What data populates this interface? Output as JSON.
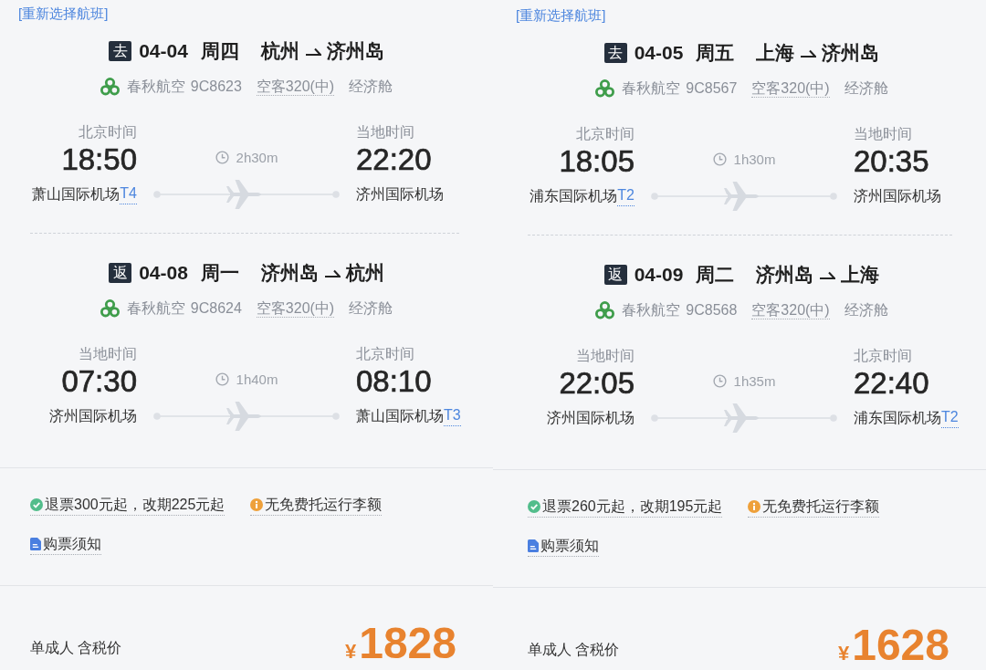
{
  "panels": [
    {
      "reselect_link": "[重新选择航班]",
      "segments": [
        {
          "badge": "去",
          "date": "04-04",
          "weekday": "周四",
          "origin": "杭州",
          "destination": "济州岛",
          "airline": "春秋航空",
          "flight_no": "9C8623",
          "aircraft": "空客320(中)",
          "cabin": "经济舱",
          "duration": "2h30m",
          "departure": {
            "zone": "北京时间",
            "time": "18:50",
            "airport": "萧山国际机场",
            "terminal": "T4"
          },
          "arrival": {
            "zone": "当地时间",
            "time": "22:20",
            "airport": "济州国际机场"
          }
        },
        {
          "badge": "返",
          "date": "04-08",
          "weekday": "周一",
          "origin": "济州岛",
          "destination": "杭州",
          "airline": "春秋航空",
          "flight_no": "9C8624",
          "aircraft": "空客320(中)",
          "cabin": "经济舱",
          "duration": "1h40m",
          "departure": {
            "zone": "当地时间",
            "time": "07:30",
            "airport": "济州国际机场"
          },
          "arrival": {
            "zone": "北京时间",
            "time": "08:10",
            "airport": "萧山国际机场",
            "terminal": "T3"
          }
        }
      ],
      "notes": [
        {
          "kind": "check",
          "text": "退票300元起，改期225元起"
        },
        {
          "kind": "info",
          "text": "无免费托运行李额"
        },
        {
          "kind": "doc",
          "text": "购票须知"
        }
      ],
      "price": {
        "label": "单成人 含税价",
        "currency": "¥",
        "amount": "1828"
      }
    },
    {
      "reselect_link": "[重新选择航班]",
      "segments": [
        {
          "badge": "去",
          "date": "04-05",
          "weekday": "周五",
          "origin": "上海",
          "destination": "济州岛",
          "airline": "春秋航空",
          "flight_no": "9C8567",
          "aircraft": "空客320(中)",
          "cabin": "经济舱",
          "duration": "1h30m",
          "departure": {
            "zone": "北京时间",
            "time": "18:05",
            "airport": "浦东国际机场",
            "terminal": "T2"
          },
          "arrival": {
            "zone": "当地时间",
            "time": "20:35",
            "airport": "济州国际机场"
          }
        },
        {
          "badge": "返",
          "date": "04-09",
          "weekday": "周二",
          "origin": "济州岛",
          "destination": "上海",
          "airline": "春秋航空",
          "flight_no": "9C8568",
          "aircraft": "空客320(中)",
          "cabin": "经济舱",
          "duration": "1h35m",
          "departure": {
            "zone": "当地时间",
            "time": "22:05",
            "airport": "济州国际机场"
          },
          "arrival": {
            "zone": "北京时间",
            "time": "22:40",
            "airport": "浦东国际机场",
            "terminal": "T2"
          }
        }
      ],
      "notes": [
        {
          "kind": "check",
          "text": "退票260元起，改期195元起"
        },
        {
          "kind": "info",
          "text": "无免费托运行李额"
        },
        {
          "kind": "doc",
          "text": "购票须知"
        }
      ],
      "price": {
        "label": "单成人 含税价",
        "currency": "¥",
        "amount": "1628"
      }
    }
  ]
}
